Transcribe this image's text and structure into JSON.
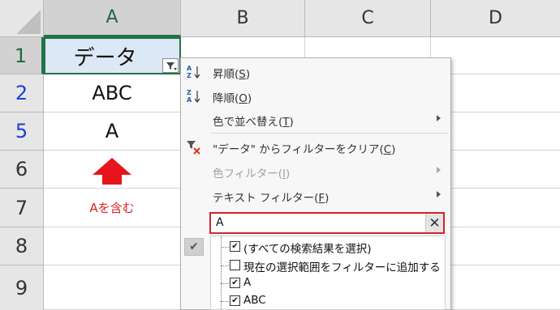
{
  "columns": [
    "A",
    "B",
    "C",
    "D"
  ],
  "rows": [
    "1",
    "2",
    "5",
    "6",
    "7",
    "8",
    "9"
  ],
  "cells": {
    "a1": "データ",
    "a2": "ABC",
    "a5": "A",
    "a7": "Aを含む"
  },
  "colors": {
    "accent": "#217346",
    "hidden_row_number": "#1a3fd6",
    "annotation": "#e02020",
    "search_border": "#d3232a"
  },
  "menu": {
    "sort_asc": {
      "label": "昇順(",
      "key": "S",
      "close": ")"
    },
    "sort_desc": {
      "label": "降順(",
      "key": "O",
      "close": ")"
    },
    "sort_color": {
      "label": "色で並べ替え(",
      "key": "T",
      "close": ")"
    },
    "clear_filter": {
      "label": "\"データ\" からフィルターをクリア(",
      "key": "C",
      "close": ")"
    },
    "color_filter": {
      "label": "色フィルター(",
      "key": "I",
      "close": ")"
    },
    "text_filter": {
      "label": "テキスト フィルター(",
      "key": "F",
      "close": ")"
    },
    "search_value": "A",
    "search_clear": "✕",
    "tree": {
      "select_all": "(すべての検索結果を選択)",
      "add_current": "現在の選択範囲をフィルターに追加する",
      "item_a": "A",
      "item_abc": "ABC"
    }
  }
}
